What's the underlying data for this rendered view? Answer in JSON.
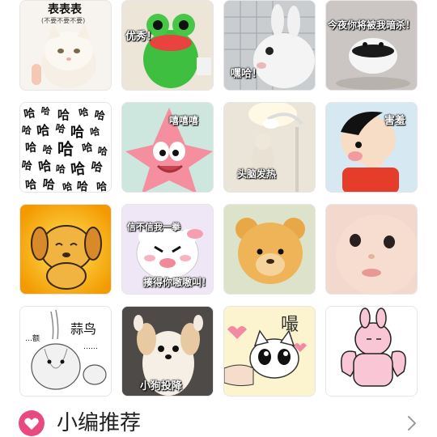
{
  "stickers": [
    {
      "id": "cat-table",
      "caption": "表表表",
      "subcaption": "(不要不要不要)"
    },
    {
      "id": "green-frog",
      "caption": "优秀！"
    },
    {
      "id": "white-rabbit",
      "caption": "嘿哈！"
    },
    {
      "id": "white-bird",
      "caption": "今夜你将被我暗杀！"
    },
    {
      "id": "ha-pattern",
      "caption": "哈"
    },
    {
      "id": "patrick-star",
      "caption": "嘻嘻嘻"
    },
    {
      "id": "cat-lamp",
      "caption": "头脑发热"
    },
    {
      "id": "shinchan",
      "caption": "害羞"
    },
    {
      "id": "yellow-dog",
      "caption": ""
    },
    {
      "id": "angry-sheep",
      "caption_top": "信不信我一拳",
      "caption": "揍得你嗷嗷叫！"
    },
    {
      "id": "teddy-bear",
      "caption": ""
    },
    {
      "id": "baby-face",
      "caption": ""
    },
    {
      "id": "garlic-bird",
      "caption": "蒜鸟",
      "subcaption": "…额",
      "dots": "……"
    },
    {
      "id": "puppy-surrender",
      "caption": "小狗投降"
    },
    {
      "id": "cat-claw",
      "caption": "嘬"
    },
    {
      "id": "pink-muscle",
      "caption": ""
    }
  ],
  "footer": {
    "title": "小编推荐",
    "accent": "#e84a7f"
  }
}
